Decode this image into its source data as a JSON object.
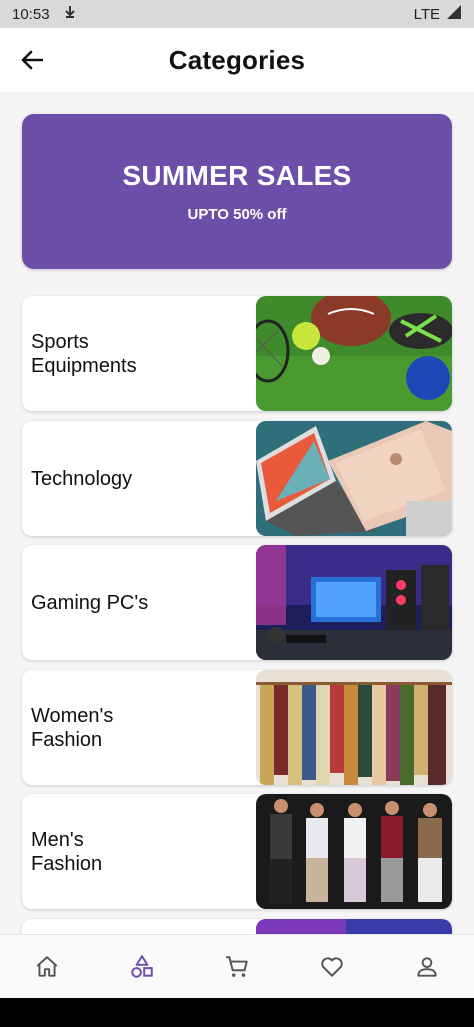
{
  "status_bar": {
    "time": "10:53",
    "network": "LTE"
  },
  "app_bar": {
    "title": "Categories"
  },
  "banner": {
    "title": "SUMMER SALES",
    "subtitle": "UPTO 50% off",
    "color": "#6b4fa8"
  },
  "categories": [
    {
      "label": "Sports\nEquipments"
    },
    {
      "label": "Technology"
    },
    {
      "label": "Gaming PC's"
    },
    {
      "label": "Women's\nFashion"
    },
    {
      "label": "Men's\nFashion"
    }
  ],
  "bottom_nav": {
    "items": [
      "home-icon",
      "categories-icon",
      "cart-icon",
      "heart-icon",
      "profile-icon"
    ],
    "active": "categories-icon",
    "active_color": "#6b4fa8",
    "inactive_color": "#555555"
  }
}
